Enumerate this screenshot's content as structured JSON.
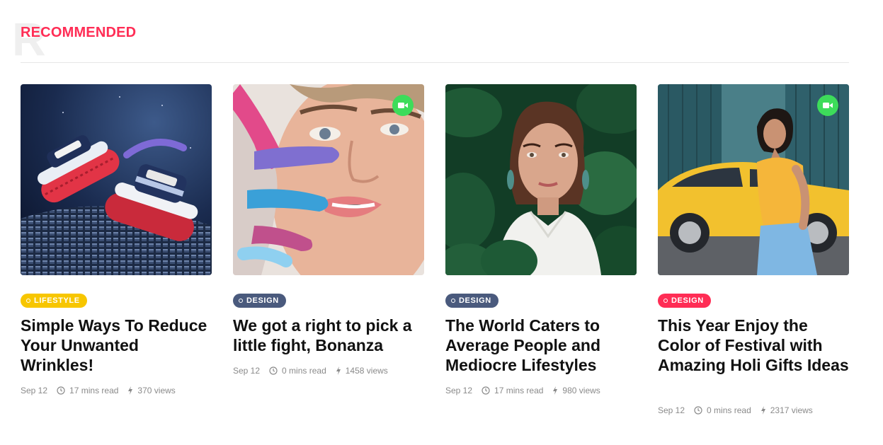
{
  "section": {
    "ghost_letter": "R",
    "title": "RECOMMENDED"
  },
  "cards": [
    {
      "category": "LIFESTYLE",
      "title": "Simple Ways To Reduce Your Unwanted Wrinkles!",
      "date": "Sep 12",
      "read_time": "17 mins read",
      "views": "370 views",
      "has_video": false,
      "accent": "#f7c600"
    },
    {
      "category": "DESIGN",
      "title": "We got a right to pick a little fight, Bonanza",
      "date": "Sep 12",
      "read_time": "0 mins read",
      "views": "1458 views",
      "has_video": true,
      "accent": "#4a5a7d"
    },
    {
      "category": "DESIGN",
      "title": "The World Caters to Average People and Mediocre Lifestyles",
      "date": "Sep 12",
      "read_time": "17 mins read",
      "views": "980 views",
      "has_video": false,
      "accent": "#4a5a7d"
    },
    {
      "category": "DESIGN",
      "title": "This Year Enjoy the Color of Festival with Amazing Holi Gifts Ideas",
      "date": "Sep 12",
      "read_time": "0 mins read",
      "views": "2317 views",
      "has_video": true,
      "accent": "#ff2d55"
    }
  ],
  "colors": {
    "brand": "#ff2d55",
    "video_badge": "#3ddc5a"
  },
  "icons": {
    "clock": "clock-icon",
    "views": "bolt-icon",
    "video": "video-camera-icon"
  }
}
